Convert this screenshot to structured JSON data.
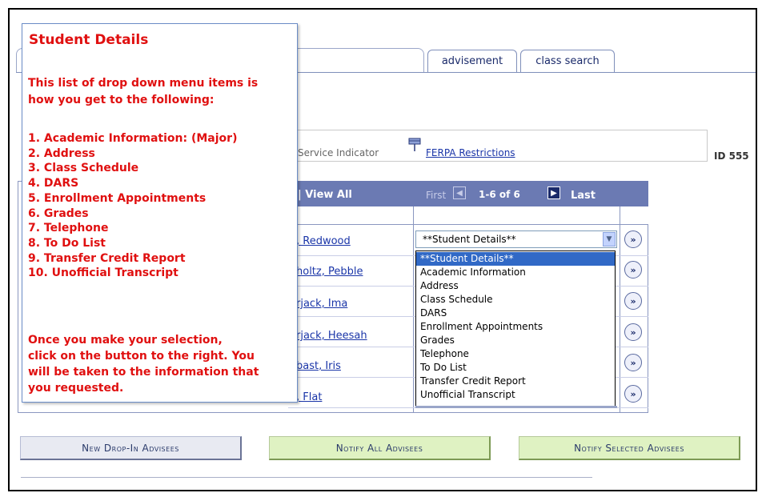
{
  "tabs": [
    {
      "label": "advisement"
    },
    {
      "label": "class search"
    }
  ],
  "service_indicator": {
    "label": "Service Indicator",
    "ferpa_link": "FERPA Restrictions",
    "id_text": "ID 555"
  },
  "grid": {
    "view_all": "| View All",
    "first": "First",
    "count": "1-6 of 6",
    "last": "Last",
    "rows": [
      {
        "name": ", Redwood"
      },
      {
        "name": "holtz, Pebble"
      },
      {
        "name": "rjack, Ima"
      },
      {
        "name": "rjack, Heesah"
      },
      {
        "name": "bast, Iris"
      },
      {
        "name": ", Flat"
      }
    ]
  },
  "select": {
    "value": "**Student Details**",
    "options": [
      "**Student Details**",
      "Academic Information",
      "Address",
      "Class Schedule",
      "DARS",
      "Enrollment Appointments",
      "Grades",
      "Telephone",
      "To Do List",
      "Transfer Credit Report",
      "Unofficial Transcript"
    ]
  },
  "info_panel": {
    "title": "Student Details",
    "intro_line1": "This list of drop down menu items is",
    "intro_line2": "how you get to the following:",
    "items": [
      "1.  Academic Information: (Major)",
      "2.  Address",
      "3.  Class Schedule",
      "4.  DARS",
      "5.  Enrollment Appointments",
      "6.  Grades",
      "7.  Telephone",
      "8.  To Do List",
      "9.  Transfer Credit Report",
      "10. Unofficial Transcript"
    ],
    "outro_line1": "Once you make your selection,",
    "outro_line2": "click on the button to the right.  You",
    "outro_line3": "will be taken to the information that",
    "outro_line4": "you requested."
  },
  "buttons": {
    "new_dropin": "New Drop-In Advisees",
    "notify_all": "Notify All Advisees",
    "notify_selected": "Notify Selected Advisees"
  },
  "colors": {
    "header_bar": "#6b7ab3",
    "info_text": "#e01010",
    "link": "#1a35a8",
    "selected_option": "#3169c6"
  },
  "icons": {
    "flag": "flag-icon",
    "go": "go-arrow-icon",
    "prev": "prev-arrow-icon",
    "next": "next-arrow-icon",
    "dropdown": "chevron-down-icon"
  }
}
